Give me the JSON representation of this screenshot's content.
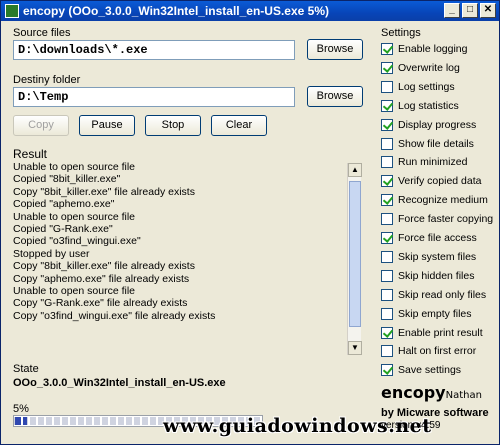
{
  "window": {
    "title": "encopy (OOo_3.0.0_Win32Intel_install_en-US.exe 5%)"
  },
  "source": {
    "label": "Source files",
    "value": "D:\\downloads\\*.exe",
    "browse": "Browse"
  },
  "destiny": {
    "label": "Destiny folder",
    "value": "D:\\Temp",
    "browse": "Browse"
  },
  "actions": {
    "copy": "Copy",
    "pause": "Pause",
    "stop": "Stop",
    "clear": "Clear"
  },
  "result": {
    "title": "Result",
    "lines": [
      "Unable to open source file",
      "Copied \"8bit_killer.exe\"",
      "Copy \"8bit_killer.exe\" file already exists",
      "Copied \"aphemo.exe\"",
      "Unable to open source file",
      "Copied \"G-Rank.exe\"",
      "Copied \"o3find_wingui.exe\"",
      "Stopped by user",
      "Copy \"8bit_killer.exe\" file already exists",
      "Copy \"aphemo.exe\" file already exists",
      "Unable to open source file",
      "Copy \"G-Rank.exe\" file already exists",
      "Copy \"o3find_wingui.exe\" file already exists"
    ]
  },
  "settings": {
    "title": "Settings",
    "items": [
      {
        "label": "Enable logging",
        "checked": true
      },
      {
        "label": "Overwrite log",
        "checked": true
      },
      {
        "label": "Log settings",
        "checked": false
      },
      {
        "label": "Log statistics",
        "checked": true
      },
      {
        "label": "Display progress",
        "checked": true
      },
      {
        "label": "Show file details",
        "checked": false
      },
      {
        "label": "Run minimized",
        "checked": false
      },
      {
        "label": "Verify copied data",
        "checked": true
      },
      {
        "label": "Recognize medium",
        "checked": true
      },
      {
        "label": "Force faster copying",
        "checked": false
      },
      {
        "label": "Force file access",
        "checked": true
      },
      {
        "label": "Skip system files",
        "checked": false
      },
      {
        "label": "Skip hidden files",
        "checked": false
      },
      {
        "label": "Skip read only files",
        "checked": false
      },
      {
        "label": "Skip empty files",
        "checked": false
      },
      {
        "label": "Enable print result",
        "checked": true
      },
      {
        "label": "Halt on first error",
        "checked": false
      },
      {
        "label": "Save settings",
        "checked": true
      }
    ]
  },
  "state": {
    "title": "State",
    "file": "OOo_3.0.0_Win32Intel_install_en-US.exe",
    "percent_label": "5%",
    "progress": 0.05
  },
  "brand": {
    "name": "encopy",
    "author": "Nathan",
    "by": "by Micware software",
    "version": "version v4.59"
  },
  "watermark": "www.guiadowindows.net"
}
